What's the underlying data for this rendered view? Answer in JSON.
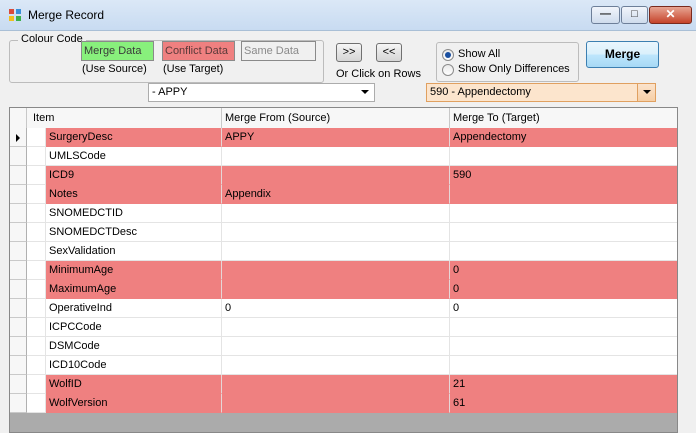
{
  "window": {
    "title": "Merge Record"
  },
  "colour_code": {
    "title": "Colour Code",
    "merge_label": "Merge Data",
    "conflict_label": "Conflict Data",
    "same_label": "Same Data",
    "use_source": "(Use Source)",
    "use_target": "(Use Target)",
    "colors": {
      "merge": "#88f07c",
      "conflict": "#ef8080",
      "same": "#f0f0f0"
    }
  },
  "toolbar": {
    "copy_right_label": ">>",
    "copy_left_label": "<<",
    "click_rows_hint": "Or Click on Rows",
    "show_all_label": "Show All",
    "show_diff_label": "Show Only Differences",
    "show_all_selected": true,
    "merge_label": "Merge"
  },
  "source_combo": {
    "value": "- APPY"
  },
  "target_combo": {
    "value": "590  - Appendectomy"
  },
  "grid": {
    "headers": [
      "Item",
      "Merge From (Source)",
      "Merge To (Target)"
    ],
    "rows": [
      {
        "item": "SurgeryDesc",
        "source": "APPY",
        "target": "Appendectomy",
        "conflict": true,
        "current": true
      },
      {
        "item": "UMLSCode",
        "source": "",
        "target": "",
        "conflict": false
      },
      {
        "item": "ICD9",
        "source": "",
        "target": "590",
        "conflict": true
      },
      {
        "item": "Notes",
        "source": "Appendix",
        "target": "",
        "conflict": true
      },
      {
        "item": "SNOMEDCTID",
        "source": "",
        "target": "",
        "conflict": false
      },
      {
        "item": "SNOMEDCTDesc",
        "source": "",
        "target": "",
        "conflict": false
      },
      {
        "item": "SexValidation",
        "source": "",
        "target": "",
        "conflict": false
      },
      {
        "item": "MinimumAge",
        "source": "",
        "target": "0",
        "conflict": true
      },
      {
        "item": "MaximumAge",
        "source": "",
        "target": "0",
        "conflict": true
      },
      {
        "item": "OperativeInd",
        "source": "0",
        "target": "0",
        "conflict": false
      },
      {
        "item": "ICPCCode",
        "source": "",
        "target": "",
        "conflict": false
      },
      {
        "item": "DSMCode",
        "source": "",
        "target": "",
        "conflict": false
      },
      {
        "item": "ICD10Code",
        "source": "",
        "target": "",
        "conflict": false
      },
      {
        "item": "WolfID",
        "source": "",
        "target": "21",
        "conflict": true
      },
      {
        "item": "WolfVersion",
        "source": "",
        "target": "61",
        "conflict": true
      }
    ]
  }
}
